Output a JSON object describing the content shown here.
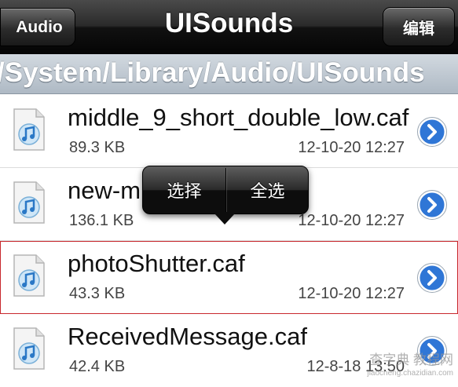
{
  "navbar": {
    "back_label": "Audio",
    "title": "UISounds",
    "edit_label": "编辑"
  },
  "path": "/System/Library/Audio/UISounds",
  "files": [
    {
      "name": "middle_9_short_double_low.caf",
      "size": "89.3 KB",
      "date": "12-10-20 12:27"
    },
    {
      "name": "new-mail.caf",
      "name_visible": "new-m",
      "size": "136.1 KB",
      "date": "12-10-20 12:27"
    },
    {
      "name": "photoShutter.caf",
      "size": "43.3 KB",
      "date": "12-10-20 12:27"
    },
    {
      "name": "ReceivedMessage.caf",
      "size": "42.4 KB",
      "date": "12-8-18 13:50"
    }
  ],
  "popup": {
    "select_label": "选择",
    "select_all_label": "全选"
  },
  "icons": {
    "file": "music-file-icon",
    "detail": "chevron-right-circle-icon"
  },
  "colors": {
    "navbar": "#1a1a1a",
    "pathbar": "#b7c2cd",
    "detail_button": "#2f76d6",
    "selection_outline": "#c8282d"
  },
  "watermark": {
    "line1": "查字典 教程网",
    "line2": "jiaocheng.chazidian.com"
  }
}
